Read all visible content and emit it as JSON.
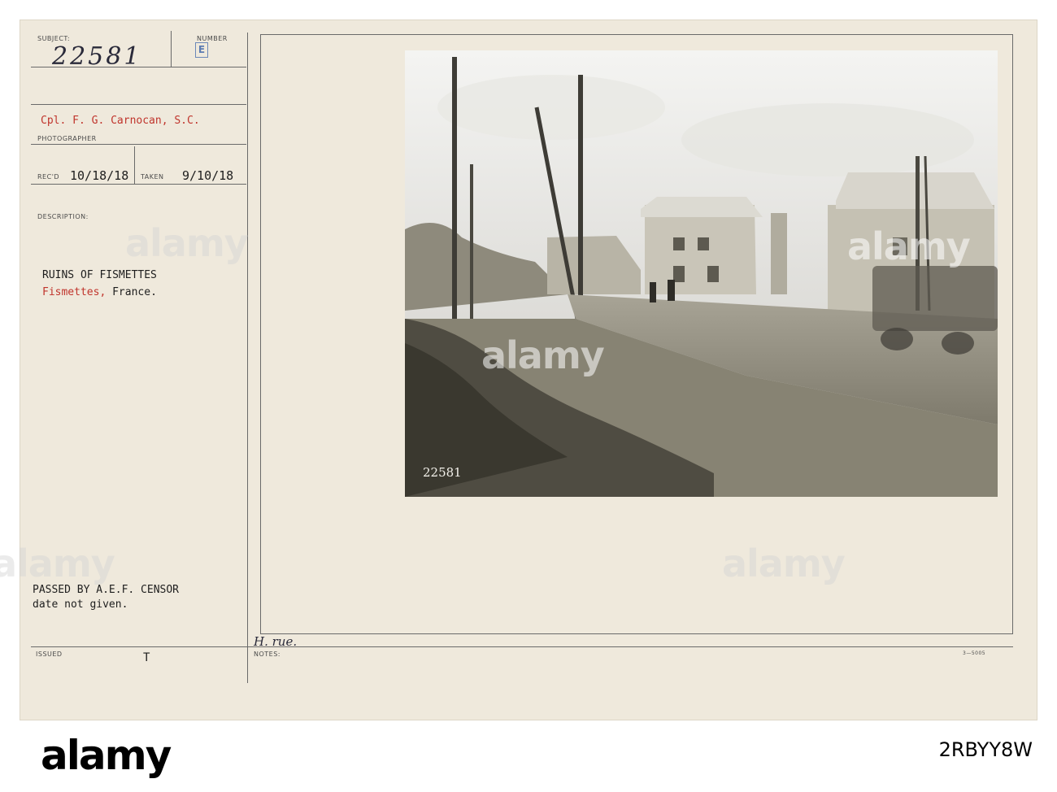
{
  "card": {
    "subject_label": "SUBJECT:",
    "subject_value": "22581",
    "number_label": "NUMBER",
    "number_stamp": "E",
    "photographer_name": "Cpl. F. G. Carnocan, S.C.",
    "photographer_label": "PHOTOGRAPHER",
    "recd_label": "REC'D",
    "recd_date": "10/18/18",
    "taken_label": "TAKEN",
    "taken_date": "9/10/18",
    "description_label": "DESCRIPTION:",
    "description_line1": "RUINS OF FISMETTES",
    "description_line2_red": "Fismettes,",
    "description_line2_black": "France.",
    "censor_line1": "PASSED BY A.E.F. CENSOR",
    "censor_line2": "date not given.",
    "issued_label": "ISSUED",
    "issued_mark": "T",
    "notes_label": "NOTES:",
    "notes_hand": "H. rue.",
    "form_number": "3—5005",
    "photo_negative_number": "22581"
  },
  "watermark": {
    "text": "alamy",
    "image_id": "2RBYY8W"
  },
  "colors": {
    "card_bg": "#efe9dc",
    "typed_red": "#c0342c",
    "stamp_blue": "#5d7cb2"
  }
}
